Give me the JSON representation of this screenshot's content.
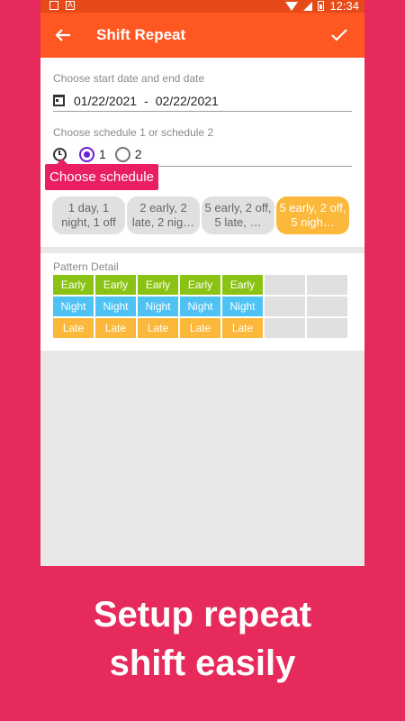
{
  "status": {
    "time": "12:34"
  },
  "appbar": {
    "title": "Shift Repeat"
  },
  "date_section": {
    "label": "Choose start date and end date",
    "start": "01/22/2021",
    "separator": "-",
    "end": "02/22/2021"
  },
  "schedule_section": {
    "label": "Choose schedule 1 or schedule 2",
    "options": [
      "1",
      "2"
    ],
    "selected": "1"
  },
  "tooltip": "Choose schedule",
  "patterns": [
    {
      "label": "1 day, 1 night, 1 off",
      "selected": false
    },
    {
      "label": "2 early, 2 late, 2 nig…",
      "selected": false
    },
    {
      "label": "5 early, 2 off, 5 late, …",
      "selected": false
    },
    {
      "label": "5 early, 2 off, 5 nigh…",
      "selected": true
    }
  ],
  "pattern_detail": {
    "label": "Pattern Detail",
    "rows": [
      {
        "cells": [
          "Early",
          "Early",
          "Early",
          "Early",
          "Early",
          "",
          ""
        ],
        "color": "#8bc314"
      },
      {
        "cells": [
          "Night",
          "Night",
          "Night",
          "Night",
          "Night",
          "",
          ""
        ],
        "color": "#4ec3f3"
      },
      {
        "cells": [
          "Late",
          "Late",
          "Late",
          "Late",
          "Late",
          "",
          ""
        ],
        "color": "#fbb83a"
      }
    ]
  },
  "caption": {
    "line1": "Setup repeat",
    "line2": "shift easily"
  },
  "colors": {
    "appbar": "#ff5722",
    "background": "#e62a5c",
    "accent": "#6a1fd3",
    "tooltip": "#e91e63"
  }
}
